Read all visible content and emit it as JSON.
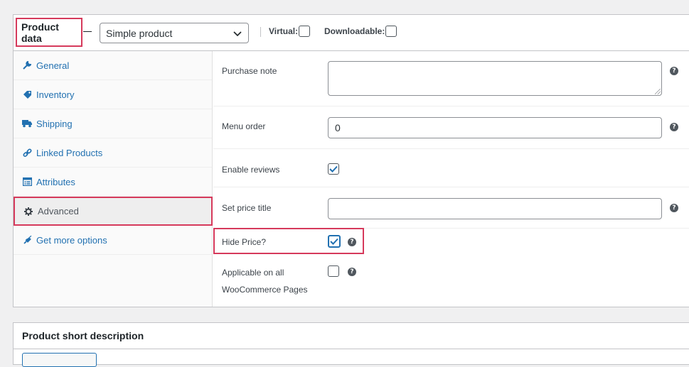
{
  "product_data": {
    "title": "Product data",
    "product_type": "Simple product",
    "virtual_label": "Virtual:",
    "downloadable_label": "Downloadable:"
  },
  "tabs": [
    {
      "label": "General",
      "icon": "wrench-icon"
    },
    {
      "label": "Inventory",
      "icon": "tag-icon"
    },
    {
      "label": "Shipping",
      "icon": "truck-icon"
    },
    {
      "label": "Linked Products",
      "icon": "link-icon"
    },
    {
      "label": "Attributes",
      "icon": "table-icon"
    },
    {
      "label": "Advanced",
      "icon": "gear-icon",
      "active": true
    },
    {
      "label": "Get more options",
      "icon": "plugin-icon"
    }
  ],
  "advanced": {
    "purchase_note_label": "Purchase note",
    "purchase_note_value": "",
    "menu_order_label": "Menu order",
    "menu_order_value": "0",
    "enable_reviews_label": "Enable reviews",
    "enable_reviews_checked": true,
    "set_price_title_label": "Set price title",
    "set_price_title_value": "",
    "hide_price_label": "Hide Price?",
    "hide_price_checked": true,
    "applicable_label_line1": "Applicable on all",
    "applicable_label_line2": "WooCommerce Pages",
    "applicable_checked": false
  },
  "short_description": {
    "title": "Product short description"
  },
  "colors": {
    "accent": "#2271b1",
    "highlight": "#d63a5c"
  }
}
